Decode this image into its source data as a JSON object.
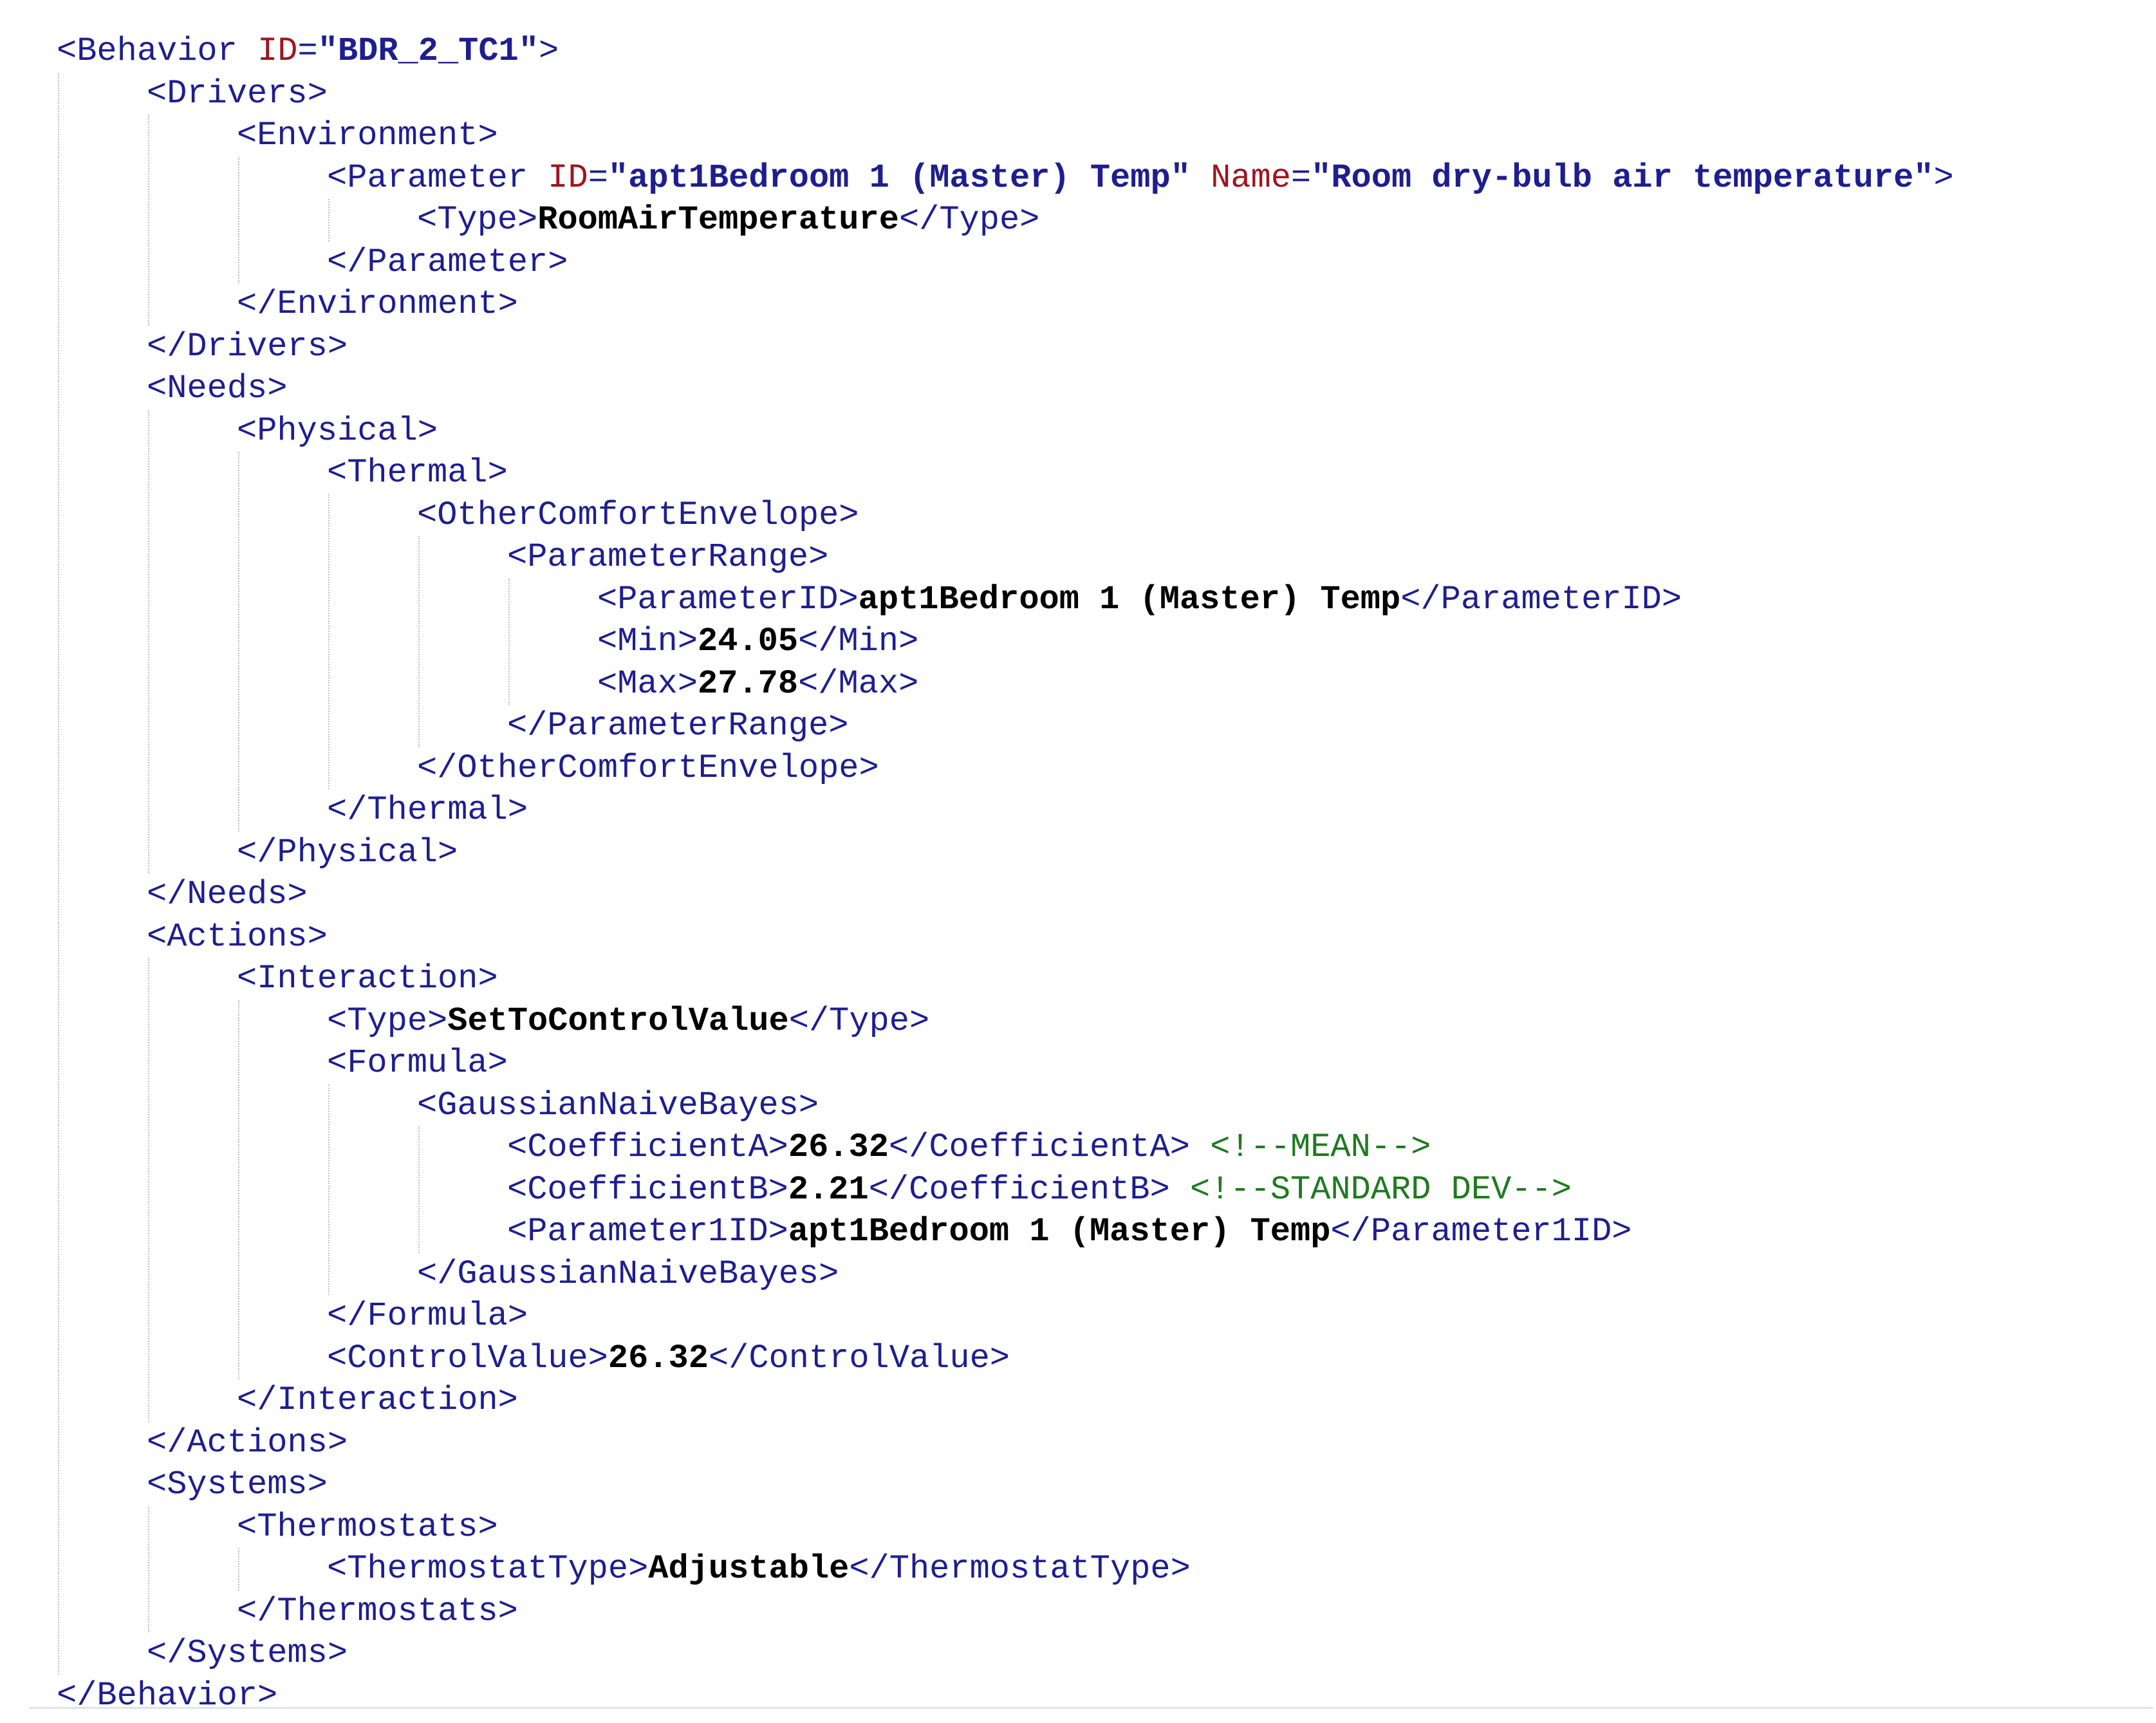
{
  "lines": [
    {
      "indent": 0,
      "parts": [
        {
          "t": "<Behavior ",
          "c": "tag"
        },
        {
          "t": "ID",
          "c": "aname"
        },
        {
          "t": "=",
          "c": "eq"
        },
        {
          "t": "\"BDR_2_TC1\"",
          "c": "aval"
        },
        {
          "t": ">",
          "c": "tag"
        }
      ]
    },
    {
      "indent": 1,
      "parts": [
        {
          "t": "<Drivers>",
          "c": "tag"
        }
      ]
    },
    {
      "indent": 2,
      "parts": [
        {
          "t": "<Environment>",
          "c": "tag"
        }
      ]
    },
    {
      "indent": 3,
      "parts": [
        {
          "t": "<Parameter ",
          "c": "tag"
        },
        {
          "t": "ID",
          "c": "aname"
        },
        {
          "t": "=",
          "c": "eq"
        },
        {
          "t": "\"apt1Bedroom 1 (Master) Temp\"",
          "c": "aval"
        },
        {
          "t": " ",
          "c": "tag"
        },
        {
          "t": "Name",
          "c": "aname"
        },
        {
          "t": "=",
          "c": "eq"
        },
        {
          "t": "\"Room dry-bulb air temperature\"",
          "c": "aval"
        },
        {
          "t": ">",
          "c": "tag"
        }
      ]
    },
    {
      "indent": 4,
      "parts": [
        {
          "t": "<Type>",
          "c": "tag"
        },
        {
          "t": "RoomAirTemperature",
          "c": "txt"
        },
        {
          "t": "</Type>",
          "c": "tag"
        }
      ]
    },
    {
      "indent": 3,
      "parts": [
        {
          "t": "</Parameter>",
          "c": "tag"
        }
      ]
    },
    {
      "indent": 2,
      "parts": [
        {
          "t": "</Environment>",
          "c": "tag"
        }
      ]
    },
    {
      "indent": 1,
      "parts": [
        {
          "t": "</Drivers>",
          "c": "tag"
        }
      ]
    },
    {
      "indent": 1,
      "parts": [
        {
          "t": "<Needs>",
          "c": "tag"
        }
      ]
    },
    {
      "indent": 2,
      "parts": [
        {
          "t": "<Physical>",
          "c": "tag"
        }
      ]
    },
    {
      "indent": 3,
      "parts": [
        {
          "t": "<Thermal>",
          "c": "tag"
        }
      ]
    },
    {
      "indent": 4,
      "parts": [
        {
          "t": "<OtherComfortEnvelope>",
          "c": "tag"
        }
      ]
    },
    {
      "indent": 5,
      "parts": [
        {
          "t": "<ParameterRange>",
          "c": "tag"
        }
      ]
    },
    {
      "indent": 6,
      "parts": [
        {
          "t": "<ParameterID>",
          "c": "tag"
        },
        {
          "t": "apt1Bedroom 1 (Master) Temp",
          "c": "txt"
        },
        {
          "t": "</ParameterID>",
          "c": "tag"
        }
      ]
    },
    {
      "indent": 6,
      "parts": [
        {
          "t": "<Min>",
          "c": "tag"
        },
        {
          "t": "24.05",
          "c": "txt"
        },
        {
          "t": "</Min>",
          "c": "tag"
        }
      ]
    },
    {
      "indent": 6,
      "parts": [
        {
          "t": "<Max>",
          "c": "tag"
        },
        {
          "t": "27.78",
          "c": "txt"
        },
        {
          "t": "</Max>",
          "c": "tag"
        }
      ]
    },
    {
      "indent": 5,
      "parts": [
        {
          "t": "</ParameterRange>",
          "c": "tag"
        }
      ]
    },
    {
      "indent": 4,
      "parts": [
        {
          "t": "</OtherComfortEnvelope>",
          "c": "tag"
        }
      ]
    },
    {
      "indent": 3,
      "parts": [
        {
          "t": "</Thermal>",
          "c": "tag"
        }
      ]
    },
    {
      "indent": 2,
      "parts": [
        {
          "t": "</Physical>",
          "c": "tag"
        }
      ]
    },
    {
      "indent": 1,
      "parts": [
        {
          "t": "</Needs>",
          "c": "tag"
        }
      ]
    },
    {
      "indent": 1,
      "parts": [
        {
          "t": "<Actions>",
          "c": "tag"
        }
      ]
    },
    {
      "indent": 2,
      "parts": [
        {
          "t": "<Interaction>",
          "c": "tag"
        }
      ]
    },
    {
      "indent": 3,
      "parts": [
        {
          "t": "<Type>",
          "c": "tag"
        },
        {
          "t": "SetToControlValue",
          "c": "txt"
        },
        {
          "t": "</Type>",
          "c": "tag"
        }
      ]
    },
    {
      "indent": 3,
      "parts": [
        {
          "t": "<Formula>",
          "c": "tag"
        }
      ]
    },
    {
      "indent": 4,
      "parts": [
        {
          "t": "<GaussianNaiveBayes>",
          "c": "tag"
        }
      ]
    },
    {
      "indent": 5,
      "parts": [
        {
          "t": "<CoefficientA>",
          "c": "tag"
        },
        {
          "t": "26.32",
          "c": "txt"
        },
        {
          "t": "</CoefficientA>",
          "c": "tag"
        },
        {
          "t": " ",
          "c": "tag"
        },
        {
          "t": "<!--MEAN-->",
          "c": "comment"
        }
      ]
    },
    {
      "indent": 5,
      "parts": [
        {
          "t": "<CoefficientB>",
          "c": "tag"
        },
        {
          "t": "2.21",
          "c": "txt"
        },
        {
          "t": "</CoefficientB>",
          "c": "tag"
        },
        {
          "t": " ",
          "c": "tag"
        },
        {
          "t": "<!--STANDARD DEV-->",
          "c": "comment"
        }
      ]
    },
    {
      "indent": 5,
      "parts": [
        {
          "t": "<Parameter1ID>",
          "c": "tag"
        },
        {
          "t": "apt1Bedroom 1 (Master) Temp",
          "c": "txt"
        },
        {
          "t": "</Parameter1ID>",
          "c": "tag"
        }
      ]
    },
    {
      "indent": 4,
      "parts": [
        {
          "t": "</GaussianNaiveBayes>",
          "c": "tag"
        }
      ]
    },
    {
      "indent": 3,
      "parts": [
        {
          "t": "</Formula>",
          "c": "tag"
        }
      ]
    },
    {
      "indent": 3,
      "parts": [
        {
          "t": "<ControlValue>",
          "c": "tag"
        },
        {
          "t": "26.32",
          "c": "txt"
        },
        {
          "t": "</ControlValue>",
          "c": "tag"
        }
      ]
    },
    {
      "indent": 2,
      "parts": [
        {
          "t": "</Interaction>",
          "c": "tag"
        }
      ]
    },
    {
      "indent": 1,
      "parts": [
        {
          "t": "</Actions>",
          "c": "tag"
        }
      ]
    },
    {
      "indent": 1,
      "parts": [
        {
          "t": "<Systems>",
          "c": "tag"
        }
      ]
    },
    {
      "indent": 2,
      "parts": [
        {
          "t": "<Thermostats>",
          "c": "tag"
        }
      ]
    },
    {
      "indent": 3,
      "parts": [
        {
          "t": "<ThermostatType>",
          "c": "tag"
        },
        {
          "t": "Adjustable",
          "c": "txt"
        },
        {
          "t": "</ThermostatType>",
          "c": "tag"
        }
      ]
    },
    {
      "indent": 2,
      "parts": [
        {
          "t": "</Thermostats>",
          "c": "tag"
        }
      ]
    },
    {
      "indent": 1,
      "parts": [
        {
          "t": "</Systems>",
          "c": "tag"
        }
      ]
    },
    {
      "indent": 0,
      "parts": [
        {
          "t": "</Behavior>",
          "c": "tag"
        }
      ]
    }
  ],
  "colors": {
    "tag": "#1e1e90",
    "attribute_name": "#a0141e",
    "attribute_value": "#1e1e90",
    "text_value": "#000000",
    "comment": "#1f7a1f",
    "indent_guide": "#c0c0c0"
  }
}
